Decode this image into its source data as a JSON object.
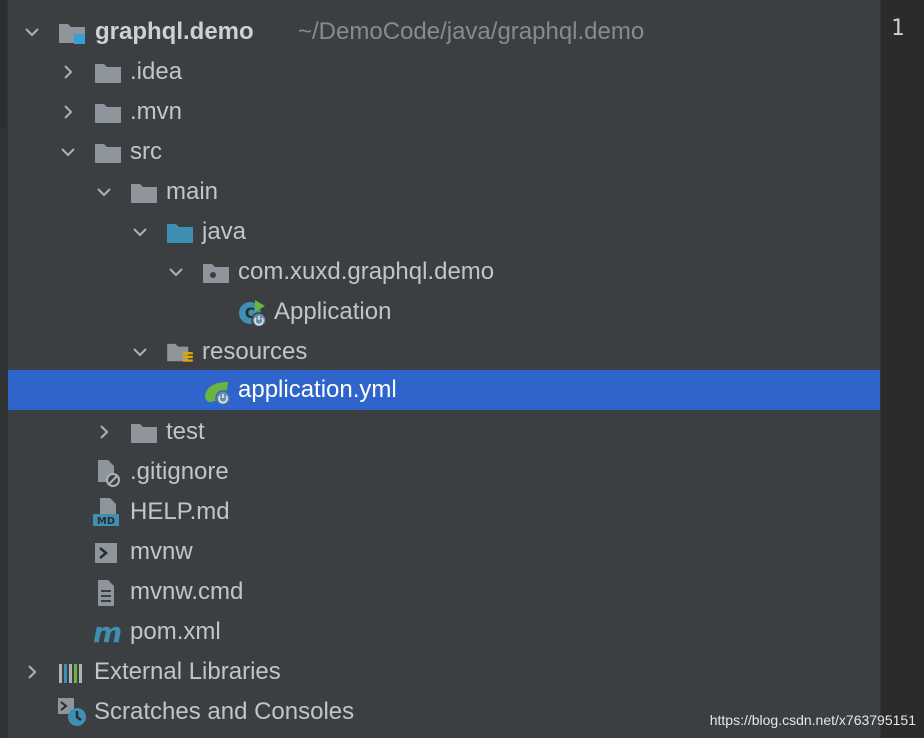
{
  "tree": {
    "root": {
      "name": "graphql.demo",
      "path": "~/DemoCode/java/graphql.demo"
    },
    "items": [
      {
        "label": ".idea"
      },
      {
        "label": ".mvn"
      },
      {
        "label": "src"
      },
      {
        "label": "main"
      },
      {
        "label": "java"
      },
      {
        "label": "com.xuxd.graphql.demo"
      },
      {
        "label": "Application"
      },
      {
        "label": "resources"
      },
      {
        "label": "application.yml"
      },
      {
        "label": "test"
      },
      {
        "label": ".gitignore"
      },
      {
        "label": "HELP.md"
      },
      {
        "label": "mvnw"
      },
      {
        "label": "mvnw.cmd"
      },
      {
        "label": "pom.xml"
      },
      {
        "label": "External Libraries"
      },
      {
        "label": "Scratches and Consoles"
      }
    ]
  },
  "editor": {
    "line_number": "1"
  },
  "watermark": "https://blog.csdn.net/x763795151",
  "colors": {
    "selection": "#2f65ca",
    "panel": "#3c3f41",
    "folder": "#8e959c",
    "java_folder": "#3f8fb2",
    "spring": "#6db33f"
  }
}
